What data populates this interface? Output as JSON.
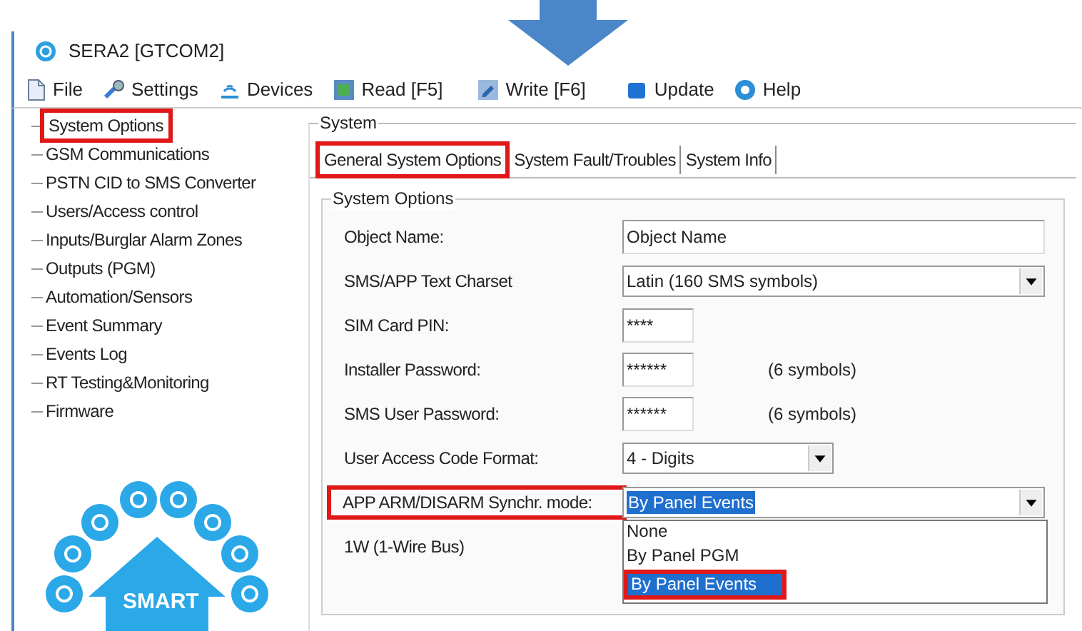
{
  "window": {
    "title": "SERA2 [GTCOM2]"
  },
  "menu": [
    {
      "label": "File"
    },
    {
      "label": "Settings"
    },
    {
      "label": "Devices"
    },
    {
      "label": "Read [F5]"
    },
    {
      "label": "Write [F6]"
    },
    {
      "label": "Update"
    },
    {
      "label": "Help"
    }
  ],
  "sidebar": {
    "items": [
      {
        "label": "System Options",
        "highlighted": true
      },
      {
        "label": "GSM Communications",
        "highlighted": false
      },
      {
        "label": "PSTN CID to SMS Converter",
        "highlighted": false
      },
      {
        "label": "Users/Access control",
        "highlighted": false
      },
      {
        "label": "Inputs/Burglar Alarm Zones",
        "highlighted": false
      },
      {
        "label": "Outputs (PGM)",
        "highlighted": false
      },
      {
        "label": "Automation/Sensors",
        "highlighted": false
      },
      {
        "label": "Event Summary",
        "highlighted": false
      },
      {
        "label": "Events Log",
        "highlighted": false
      },
      {
        "label": "RT Testing&Monitoring",
        "highlighted": false
      },
      {
        "label": "Firmware",
        "highlighted": false
      }
    ],
    "logo": {
      "text": "SMART"
    }
  },
  "panel": {
    "title": "System",
    "tabs": [
      {
        "label": "General System Options",
        "selected": true,
        "highlighted": true
      },
      {
        "label": "System Fault/Troubles",
        "selected": false,
        "highlighted": false
      },
      {
        "label": "System Info",
        "selected": false,
        "highlighted": false
      }
    ],
    "group": {
      "title": "System Options",
      "fields": [
        {
          "kind": "text",
          "label": "Object Name:",
          "value": "Object Name",
          "highlighted": false
        },
        {
          "kind": "select",
          "label": "SMS/APP Text Charset",
          "value": "Latin (160 SMS symbols)",
          "highlighted": false
        },
        {
          "kind": "password",
          "label": "SIM Card PIN:",
          "value": "****",
          "highlighted": false
        },
        {
          "kind": "password",
          "label": "Installer Password:",
          "value": "******",
          "note": "(6 symbols)",
          "highlighted": false
        },
        {
          "kind": "password",
          "label": "SMS User Password:",
          "value": "******",
          "note": "(6 symbols)",
          "highlighted": false
        },
        {
          "kind": "select",
          "label": "User Access Code Format:",
          "value": "4 - Digits",
          "highlighted": false
        },
        {
          "kind": "select",
          "label": "APP ARM/DISARM Synchr. mode:",
          "value": "By Panel Events",
          "highlighted": true,
          "focused": true,
          "options": [
            {
              "label": "None",
              "selected": false,
              "highlighted": false
            },
            {
              "label": "By Panel PGM",
              "selected": false,
              "highlighted": false
            },
            {
              "label": "By Panel Events",
              "selected": true,
              "highlighted": true
            }
          ]
        },
        {
          "kind": "label",
          "label": "1W (1-Wire Bus)",
          "highlighted": false
        }
      ]
    }
  }
}
